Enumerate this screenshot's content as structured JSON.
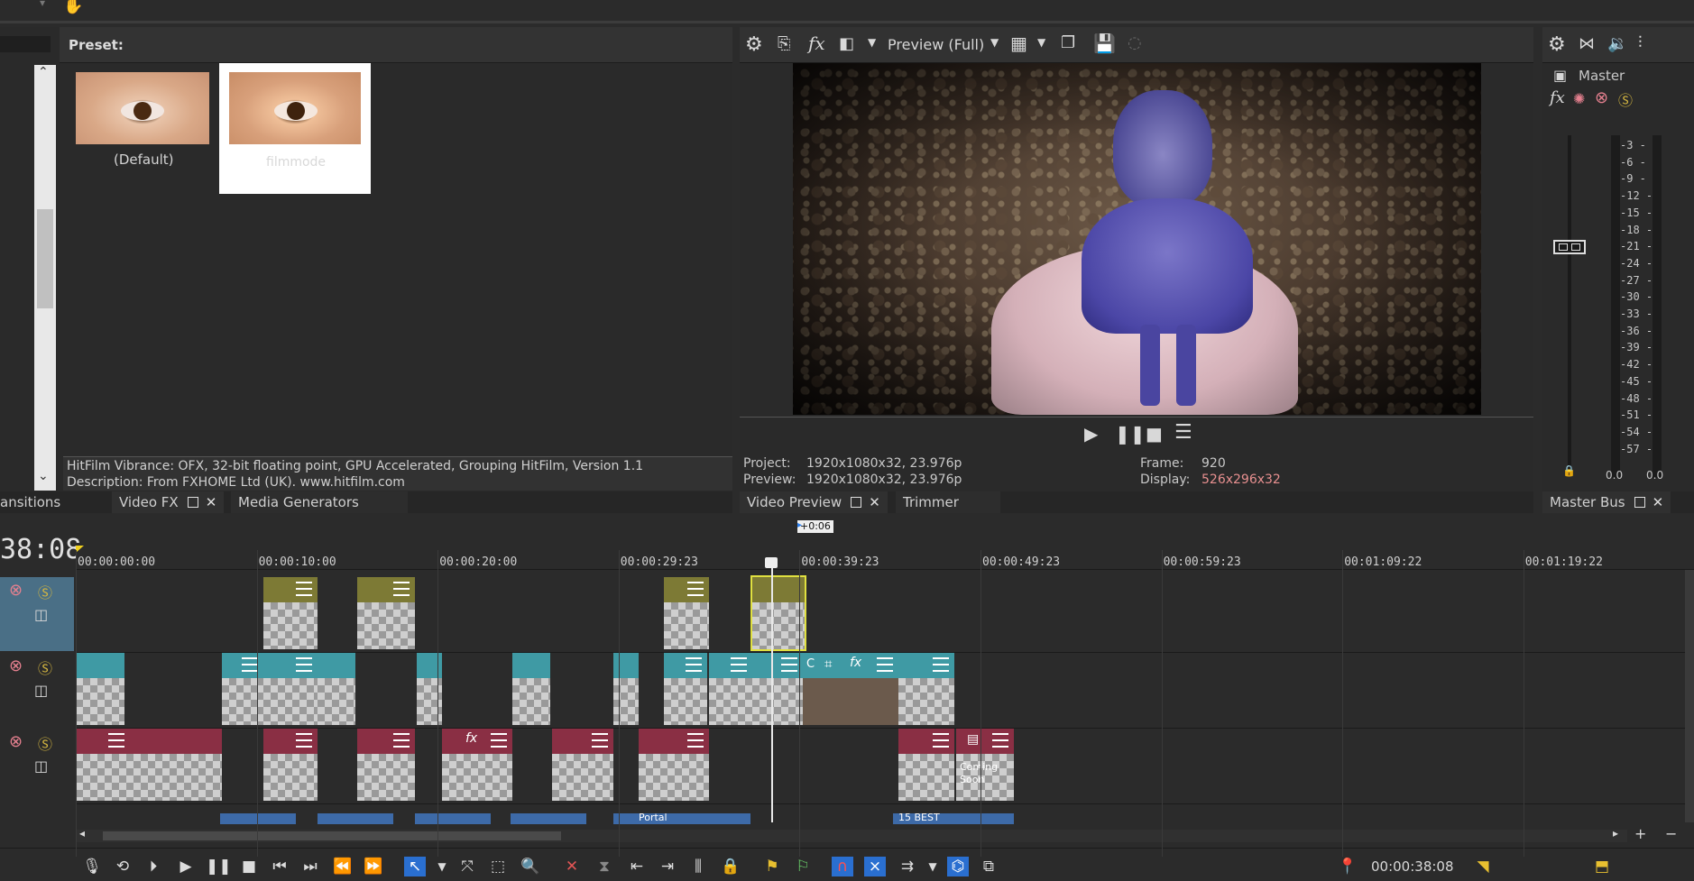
{
  "preset_panel": {
    "preset_label": "Preset:",
    "presets": [
      {
        "label": "(Default)"
      },
      {
        "label": "filmmode"
      }
    ],
    "info_line1": "HitFilm Vibrance: OFX, 32-bit floating point, GPU Accelerated, Grouping HitFilm, Version 1.1",
    "info_line2": "Description: From FXHOME Ltd (UK). www.hitfilm.com"
  },
  "left_tabs": {
    "transitions": "ansitions",
    "video_fx": "Video FX",
    "media_generators": "Media Generators"
  },
  "preview": {
    "mode_label": "Preview (Full)",
    "project_label": "Project:",
    "project_value": "1920x1080x32, 23.976p",
    "preview_label": "Preview:",
    "preview_value": "1920x1080x32, 23.976p",
    "frame_label": "Frame:",
    "frame_value": "920",
    "display_label": "Display:",
    "display_value": "526x296x32",
    "tab_video_preview": "Video Preview",
    "tab_trimmer": "Trimmer"
  },
  "master": {
    "label": "Master",
    "scale": [
      "3",
      "6",
      "9",
      "12",
      "15",
      "18",
      "21",
      "24",
      "27",
      "30",
      "33",
      "36",
      "39",
      "42",
      "45",
      "48",
      "51",
      "54",
      "57"
    ],
    "left_val": "0.0",
    "right_val": "0.0",
    "tab_label": "Master Bus"
  },
  "timeline": {
    "current_time": "38:08",
    "offset_badge": "+0:06",
    "ruler": [
      "00:00:00:00",
      "00:00:10:00",
      "00:00:20:00",
      "00:00:29:23",
      "00:00:39:23",
      "00:00:49:23",
      "00:00:59:23",
      "00:01:09:22",
      "00:01:19:22"
    ],
    "clip_texts": {
      "portal": "Portal",
      "best": "15 BEST",
      "coming": "Coming Soon",
      "c": "C"
    },
    "cursor_time": "00:00:38:08"
  },
  "colors": {
    "olive": "#7d7a35",
    "teal": "#3f9aa4",
    "maroon": "#8a2f44",
    "blue": "#3d6aa8",
    "accent_red": "#e89090"
  }
}
